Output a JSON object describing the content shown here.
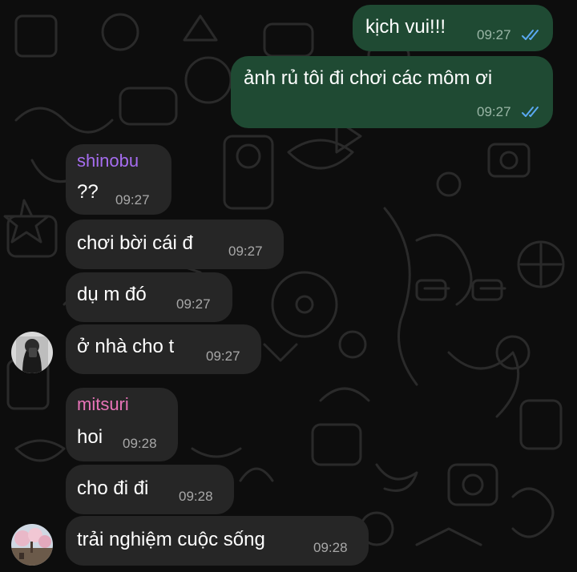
{
  "colors": {
    "background": "#0d0d0d",
    "outgoing_bubble": "#1f4a33",
    "incoming_bubble": "#262626",
    "read_check": "#5aa9f2",
    "sender_shinobu": "#a66df0",
    "sender_mitsuri": "#e874b8"
  },
  "messages": [
    {
      "direction": "outgoing",
      "text": "kịch vui!!!",
      "time": "09:27",
      "status_icon": "double-check-icon"
    },
    {
      "direction": "outgoing",
      "text": "ảnh rủ tôi đi chơi các môm ơi",
      "time": "09:27",
      "status_icon": "double-check-icon"
    },
    {
      "direction": "incoming",
      "sender": "shinobu",
      "text": "??",
      "time": "09:27"
    },
    {
      "direction": "incoming",
      "text": "chơi bời cái đ",
      "time": "09:27"
    },
    {
      "direction": "incoming",
      "text": "dụ m đó",
      "time": "09:27"
    },
    {
      "direction": "incoming",
      "text": "ở nhà cho t",
      "time": "09:27",
      "avatar": "avatar-shinobu"
    },
    {
      "direction": "incoming",
      "sender": "mitsuri",
      "text": "hoi",
      "time": "09:28"
    },
    {
      "direction": "incoming",
      "text": "cho đi đi",
      "time": "09:28"
    },
    {
      "direction": "incoming",
      "text": "trải nghiệm cuộc sống",
      "time": "09:28",
      "avatar": "avatar-mitsuri"
    }
  ]
}
